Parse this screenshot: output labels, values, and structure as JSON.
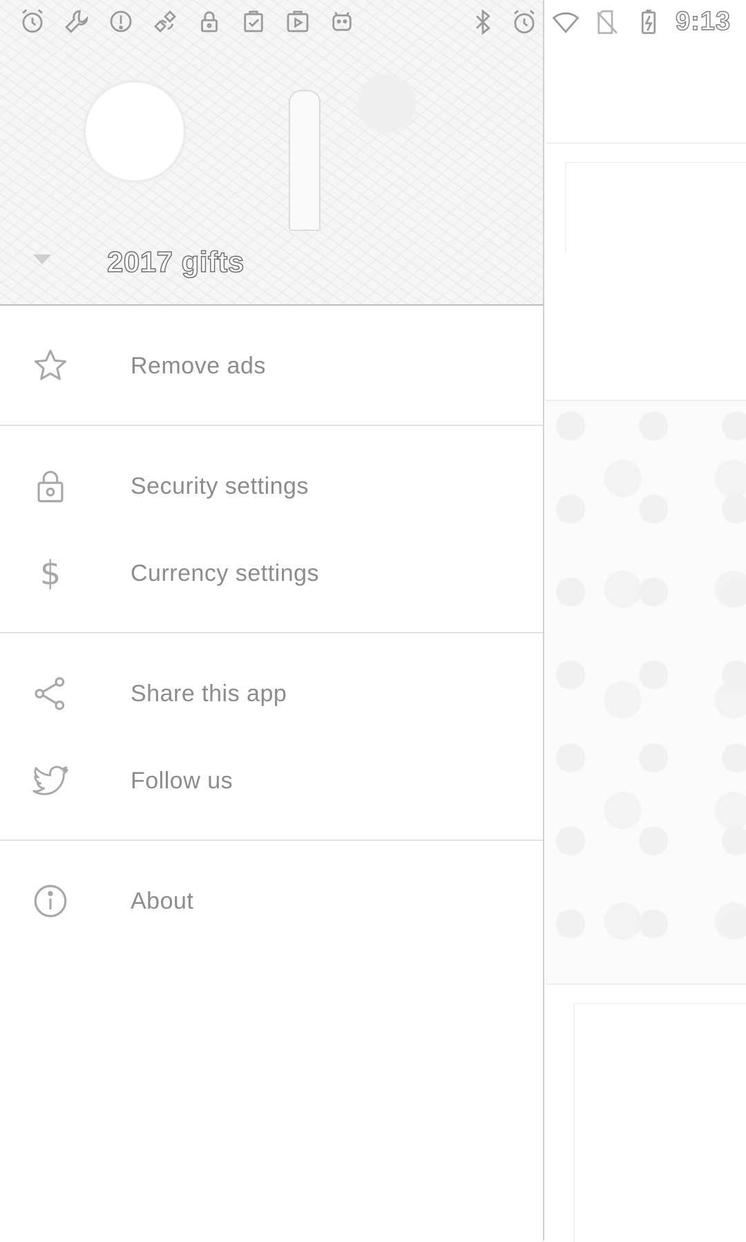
{
  "status_bar": {
    "time": "9:13",
    "left_icons": [
      "alarm-icon",
      "wrench-icon",
      "sync-icon",
      "satellite-icon",
      "lock-icon",
      "clipboard-check-icon",
      "play-store-icon",
      "android-icon"
    ],
    "right_icons": [
      "bluetooth-icon",
      "alarm-icon",
      "wifi-icon",
      "no-sim-icon",
      "battery-charging-icon"
    ]
  },
  "drawer": {
    "account": {
      "name": "2017 gifts",
      "dropdown_icon": "triangle-down-icon"
    },
    "sections": [
      {
        "items": [
          {
            "icon": "star-icon",
            "label": "Remove ads"
          }
        ]
      },
      {
        "items": [
          {
            "icon": "lock-icon",
            "label": "Security settings"
          },
          {
            "icon": "dollar-icon",
            "label": "Currency settings"
          }
        ]
      },
      {
        "items": [
          {
            "icon": "share-icon",
            "label": "Share this app"
          },
          {
            "icon": "twitter-icon",
            "label": "Follow us"
          }
        ]
      },
      {
        "items": [
          {
            "icon": "info-icon",
            "label": "About"
          }
        ]
      }
    ]
  },
  "colors": {
    "menu_text": "#8c8c8c",
    "icon": "#a8a8a8",
    "divider": "#e2e2e2",
    "drawer_edge": "#cfcfcf"
  }
}
